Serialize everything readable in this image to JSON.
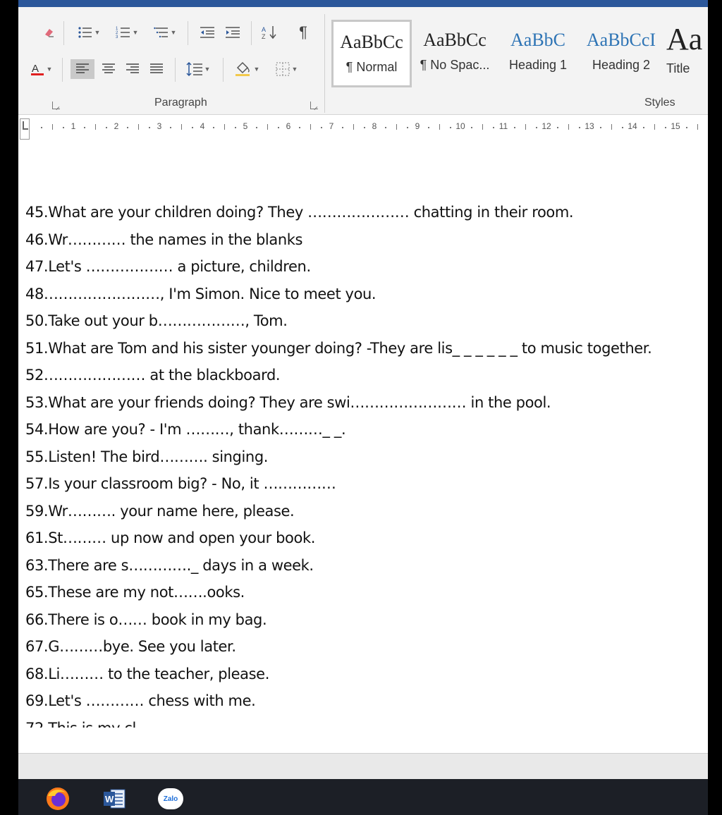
{
  "ribbon": {
    "paragraph_group_label": "Paragraph",
    "styles_group_label": "Styles",
    "styles": [
      {
        "sample": "AaBbCc",
        "name": "¶ Normal",
        "color": "#222222",
        "selected": true
      },
      {
        "sample": "AaBbCc",
        "name": "¶ No Spac...",
        "color": "#222222",
        "selected": false
      },
      {
        "sample": "AaBbC",
        "name": "Heading 1",
        "color": "#2e74b5",
        "selected": false
      },
      {
        "sample": "AaBbCcI",
        "name": "Heading 2",
        "color": "#2e74b5",
        "selected": false
      },
      {
        "sample": "Aa",
        "name": "Title",
        "color": "#222222",
        "selected": false
      }
    ],
    "accent_color": "#2b579a"
  },
  "ruler": {
    "numbers": [
      "1",
      "2",
      "3",
      "4",
      "5",
      "6",
      "7",
      "8",
      "9",
      "10",
      "11",
      "12",
      "13",
      "14",
      "15"
    ]
  },
  "document": {
    "lines": [
      "45.What are your children doing?  They ………………… chatting in their room.",
      "46.Wr…………  the names in the blanks",
      "47.Let's ……………… a picture, children.",
      "48……………………, I'm Simon. Nice to meet you.",
      "50.Take out your b………………, Tom.",
      "51.What are Tom and his sister younger doing? -They are lis_ _ _ _ _ _  to music together.",
      "52………………… at the blackboard.",
      "53.What are your friends doing? They are swi……………………  in the pool.",
      "54.How are you? - I'm ………, thank………_ _.",
      "55.Listen! The bird………. singing.",
      "57.Is your classroom big? - No, it ……………",
      "59.Wr……….   your name here, please.",
      "61.St……… up now and open your book.",
      "63.There are s…………._ days in a week.",
      "65.These are my not…….ooks.",
      "66.There is o……  book  in my bag.",
      "67.G………bye. See you later.",
      "68.Li……… to the teacher, please.",
      "69.Let's ………… chess with me.",
      "72.This is my cl"
    ]
  },
  "taskbar": {
    "apps": [
      {
        "name": "Firefox",
        "icon": "firefox-icon"
      },
      {
        "name": "Word",
        "icon": "word-icon",
        "label": "W"
      },
      {
        "name": "Zalo",
        "icon": "zalo-icon",
        "label": "Zalo"
      }
    ]
  }
}
